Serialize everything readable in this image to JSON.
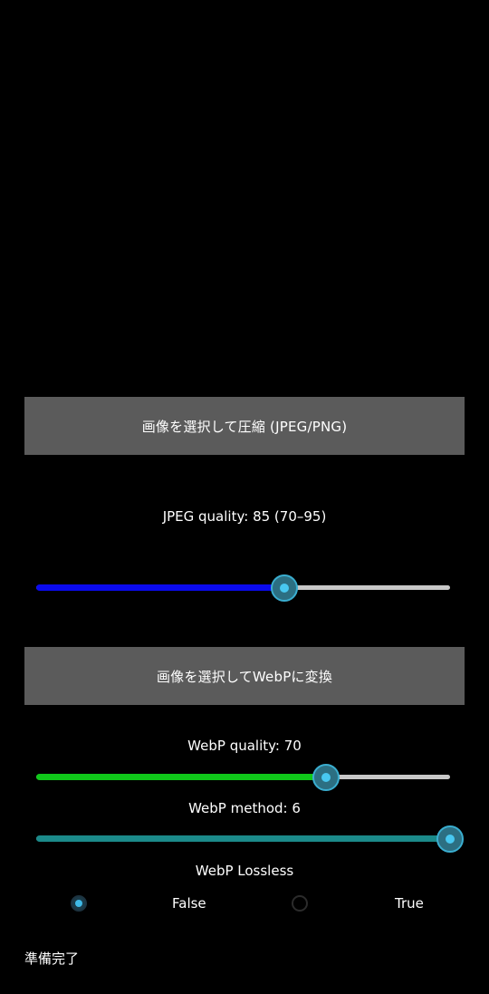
{
  "buttons": {
    "compress_label": "画像を選択して圧縮 (JPEG/PNG)",
    "webp_label": "画像を選択してWebPに変換"
  },
  "jpeg": {
    "quality_label": "JPEG quality: 85 (70–95)",
    "quality_value": 85,
    "quality_min": 70,
    "quality_max": 95,
    "fill_color": "#0a0aee"
  },
  "webp": {
    "quality_label": "WebP quality: 70",
    "quality_value": 70,
    "quality_fraction": 0.7,
    "quality_fill_color": "#10c81a",
    "method_label": "WebP method: 6",
    "method_value": 6,
    "method_fraction": 1.0,
    "method_fill_color": "#1b8a8a",
    "lossless_label": "WebP Lossless",
    "lossless_options": [
      "False",
      "True"
    ],
    "lossless_selected": "False"
  },
  "status": {
    "text": "準備完了"
  },
  "colors": {
    "background": "#000000",
    "button": "#5b5b5b",
    "track": "#c8c8c8",
    "thumb_accent": "#3aaed0"
  }
}
